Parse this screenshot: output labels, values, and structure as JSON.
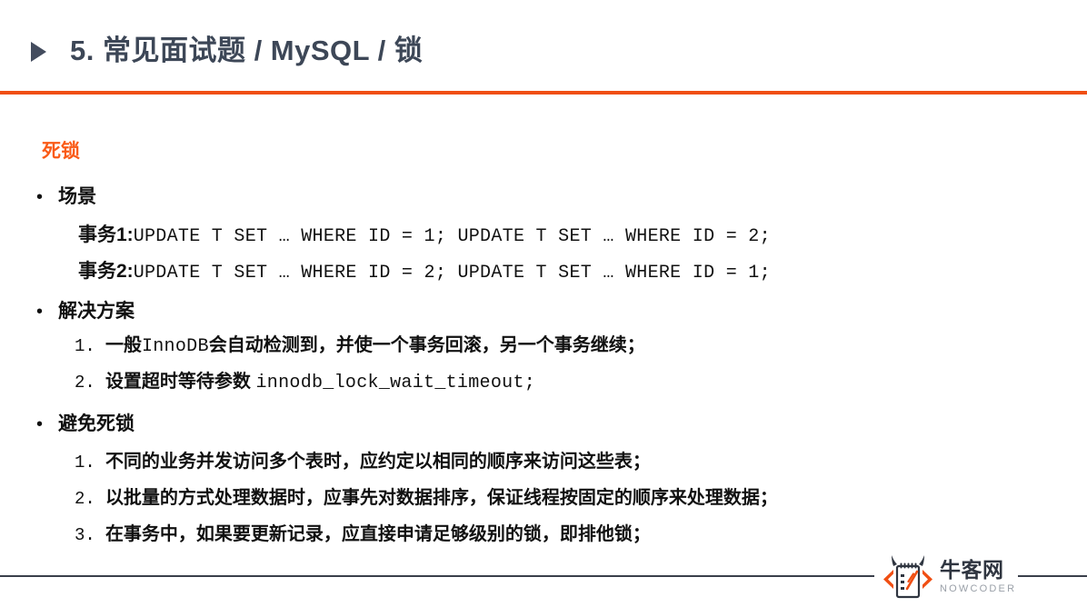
{
  "slide": {
    "title": "5. 常见面试题 / MySQL / 锁",
    "marker_icon": "triangle-right-icon",
    "accent_color": "#F04E12",
    "title_color": "#3d4757"
  },
  "content": {
    "section_heading": "死锁",
    "blocks": [
      {
        "bullet": "•",
        "label": "场景",
        "code_lines": [
          {
            "prefix": "事务1:",
            "code": "UPDATE T SET … WHERE ID = 1; UPDATE T SET … WHERE ID = 2;"
          },
          {
            "prefix": "事务2:",
            "code": "UPDATE T SET … WHERE ID = 2; UPDATE T SET … WHERE ID = 1;"
          }
        ]
      },
      {
        "bullet": "•",
        "label": "解决方案",
        "items": [
          {
            "num": "1.",
            "text_a": "一般",
            "mono": "InnoDB",
            "text_b": "会自动检测到，并使一个事务回滚，另一个事务继续；"
          },
          {
            "num": "2.",
            "text_a": "设置超时等待参数 ",
            "mono": "innodb_lock_wait_timeout;",
            "text_b": ""
          }
        ]
      },
      {
        "bullet": "•",
        "label": "避免死锁",
        "items": [
          {
            "num": "1.",
            "text_a": "不同的业务并发访问多个表时，应约定以相同的顺序来访问这些表；",
            "mono": "",
            "text_b": ""
          },
          {
            "num": "2.",
            "text_a": "以批量的方式处理数据时，应事先对数据排序，保证线程按固定的顺序来处理数据；",
            "mono": "",
            "text_b": ""
          },
          {
            "num": "3.",
            "text_a": "在事务中，如果要更新记录，应直接申请足够级别的锁，即排他锁；",
            "mono": "",
            "text_b": ""
          }
        ]
      }
    ]
  },
  "footer": {
    "logo_icon": "nowcoder-notepad-icon",
    "logo_cn": "牛客网",
    "logo_en": "NOWCODER",
    "rule_color": "#3a3f4a"
  }
}
